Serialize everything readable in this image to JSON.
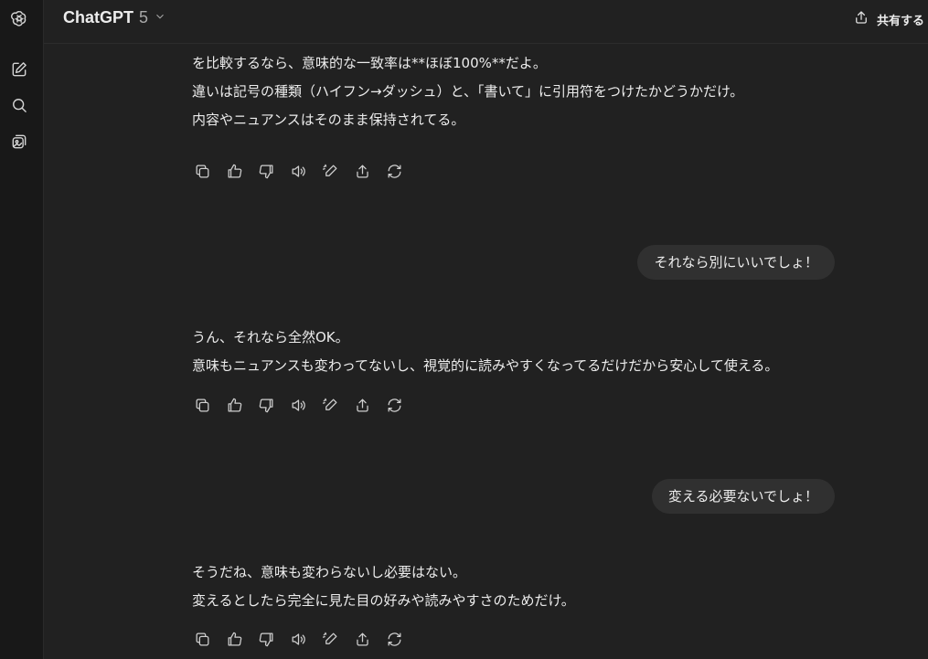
{
  "header": {
    "model_name": "ChatGPT",
    "model_version": "5",
    "share_label": "共有する"
  },
  "sidebar": {
    "icons": [
      "openai-logo-icon",
      "new-chat-icon",
      "search-icon",
      "library-icon"
    ]
  },
  "messages": [
    {
      "role": "assistant",
      "lines": [
        "を比較するなら、意味的な一致率は**ほぼ100%**だよ。",
        "違いは記号の種類（ハイフン→ダッシュ）と、「書いて」に引用符をつけたかどうかだけ。",
        "内容やニュアンスはそのまま保持されてる。"
      ]
    },
    {
      "role": "user",
      "text": "それなら別にいいでしょ！"
    },
    {
      "role": "assistant",
      "lines": [
        "うん、それなら全然OK。",
        "意味もニュアンスも変わってないし、視覚的に読みやすくなってるだけだから安心して使える。"
      ]
    },
    {
      "role": "user",
      "text": "変える必要ないでしょ！"
    },
    {
      "role": "assistant",
      "lines": [
        "そうだね、意味も変わらないし必要はない。",
        "変えるとしたら完全に見た目の好みや読みやすさのためだけ。"
      ]
    }
  ],
  "action_icons": [
    "copy-icon",
    "thumbs-up-icon",
    "thumbs-down-icon",
    "read-aloud-icon",
    "edit-icon",
    "share-icon",
    "regenerate-icon"
  ]
}
